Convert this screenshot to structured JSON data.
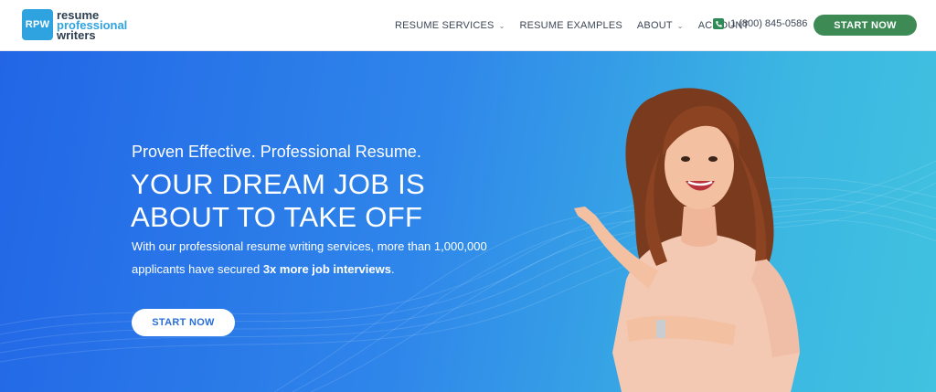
{
  "header": {
    "logo_badge": "RPW",
    "logo_line1": "resume",
    "logo_line2": "professional",
    "logo_line3": "writers",
    "nav": [
      {
        "label": "RESUME SERVICES",
        "has_dropdown": true
      },
      {
        "label": "RESUME EXAMPLES",
        "has_dropdown": false
      },
      {
        "label": "ABOUT",
        "has_dropdown": true
      },
      {
        "label": "ACCOUNT",
        "has_dropdown": false
      }
    ],
    "phone": "1 (800) 845-0586",
    "cta": "START NOW"
  },
  "hero": {
    "tagline": "Proven Effective. Professional Resume.",
    "headline_line1": "YOUR DREAM JOB IS",
    "headline_line2": "ABOUT TO TAKE OFF",
    "desc_part1": "With our professional resume writing services, more than 1,000,000 applicants have secured ",
    "desc_bold": "3x more job interviews",
    "desc_end": ".",
    "cta": "START NOW"
  },
  "icons": {
    "dropdown": "chevron-down-icon",
    "phone": "phone-icon"
  },
  "colors": {
    "brand_blue": "#2fa3e0",
    "cta_green": "#3d8a55",
    "hero_start": "#2266e6",
    "hero_end": "#41c2e0"
  }
}
